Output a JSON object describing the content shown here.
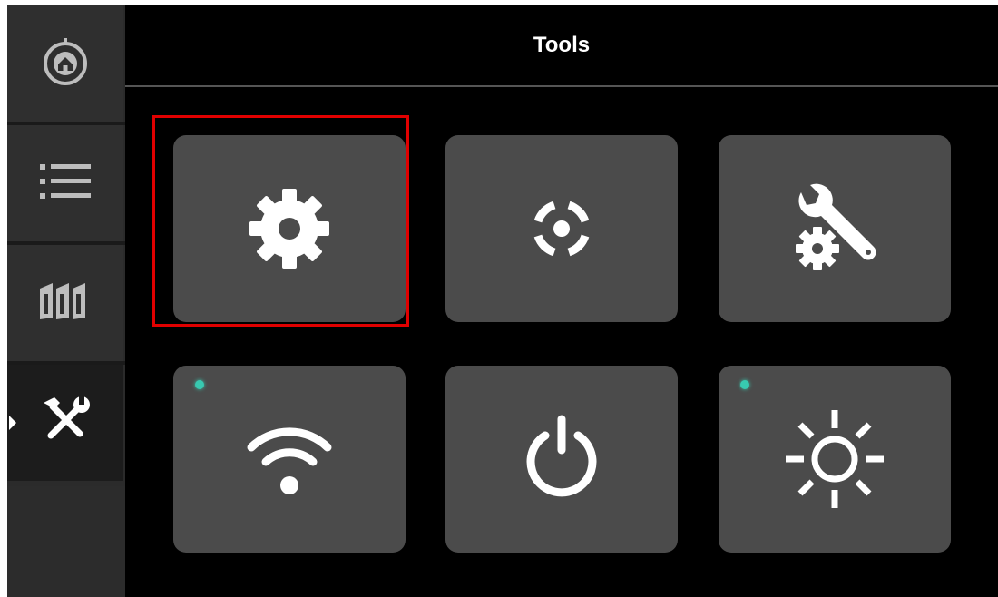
{
  "header": {
    "title": "Tools"
  },
  "sidebar": {
    "items": [
      {
        "name": "home",
        "icon": "home-icon",
        "active": false
      },
      {
        "name": "list",
        "icon": "list-icon",
        "active": false
      },
      {
        "name": "filaments",
        "icon": "filament-spools-icon",
        "active": false
      },
      {
        "name": "tools",
        "icon": "tools-icon",
        "active": true
      }
    ]
  },
  "tiles": [
    {
      "name": "settings",
      "icon": "gear-icon",
      "highlighted": true,
      "status_indicator": false
    },
    {
      "name": "calibration",
      "icon": "target-icon",
      "highlighted": false,
      "status_indicator": false
    },
    {
      "name": "maintenance",
      "icon": "wrench-gear-icon",
      "highlighted": false,
      "status_indicator": false
    },
    {
      "name": "wifi",
      "icon": "wifi-icon",
      "highlighted": false,
      "status_indicator": true
    },
    {
      "name": "power",
      "icon": "power-icon",
      "highlighted": false,
      "status_indicator": false
    },
    {
      "name": "brightness",
      "icon": "brightness-icon",
      "highlighted": false,
      "status_indicator": true
    }
  ],
  "colors": {
    "background": "#000000",
    "sidebar": "#2f2f2f",
    "tile": "#4b4b4b",
    "icon": "#ffffff",
    "status_dot": "#38c9b0",
    "highlight_border": "#e00000"
  }
}
